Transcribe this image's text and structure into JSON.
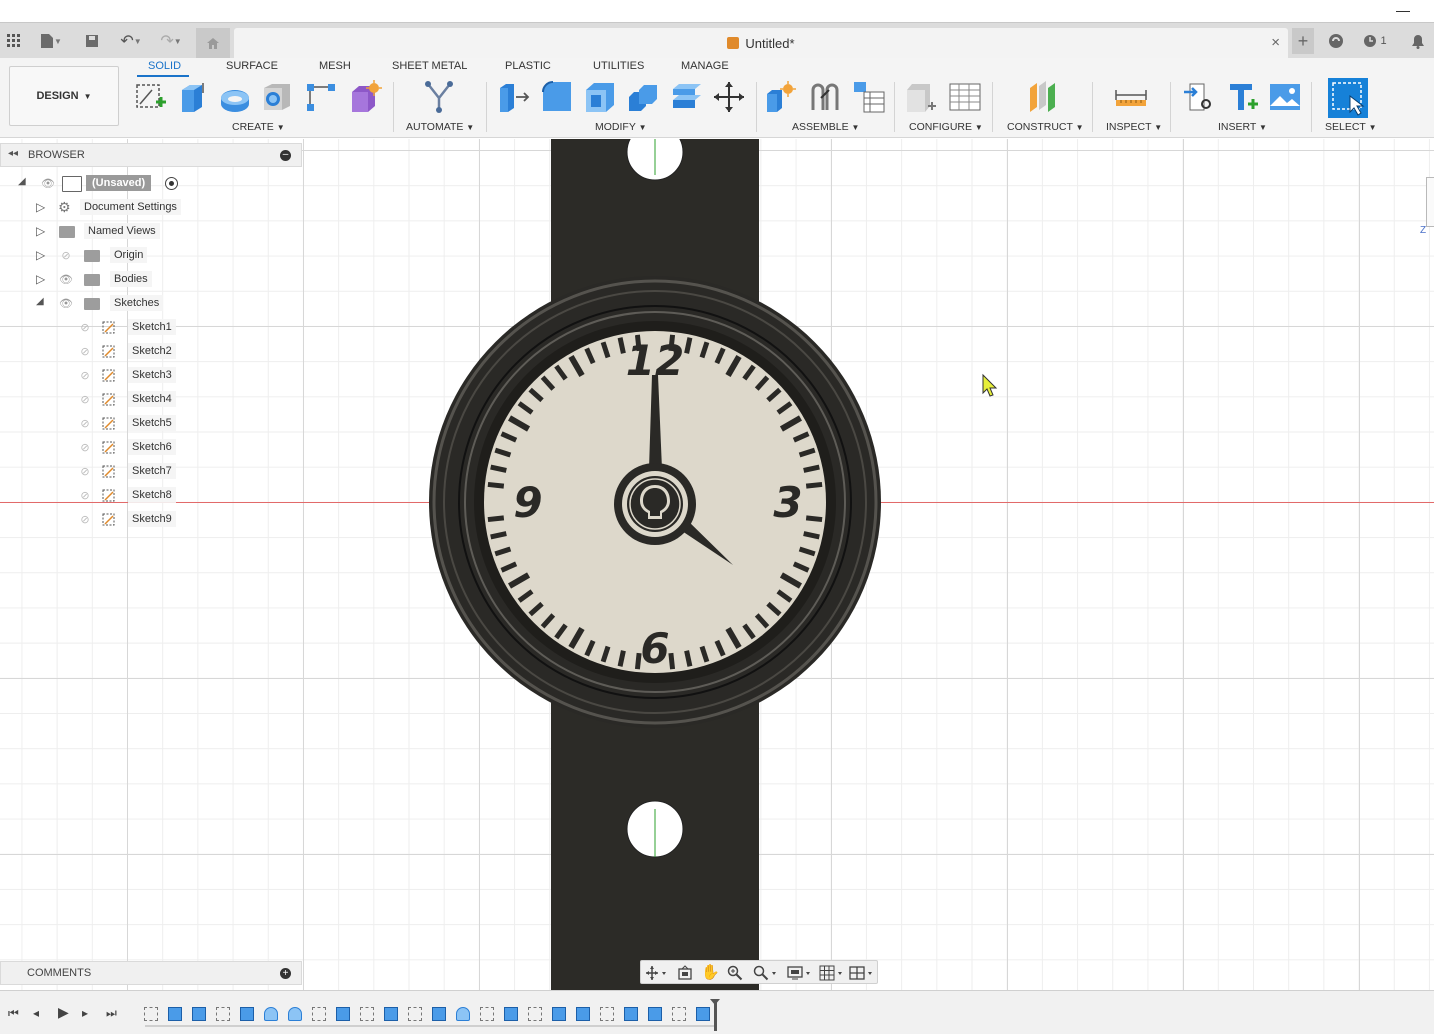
{
  "window": {
    "minimize_glyph": "—"
  },
  "appbar": {
    "icons": [
      "grid-icon",
      "file-icon",
      "save-icon",
      "undo-icon",
      "redo-icon",
      "home-icon"
    ],
    "doc_title": "Untitled*",
    "close_glyph": "×",
    "right": {
      "add_glyph": "+",
      "jobs_count": "1"
    }
  },
  "ribbon": {
    "workspace": "DESIGN",
    "tabs": [
      "SOLID",
      "SURFACE",
      "MESH",
      "SHEET METAL",
      "PLASTIC",
      "UTILITIES",
      "MANAGE"
    ],
    "active_tab": "SOLID",
    "groups": [
      "CREATE",
      "AUTOMATE",
      "MODIFY",
      "ASSEMBLE",
      "CONFIGURE",
      "CONSTRUCT",
      "INSPECT",
      "INSERT",
      "SELECT"
    ],
    "colors": {
      "accent": "#1a73c9",
      "select_bg": "#1681d8"
    }
  },
  "browser": {
    "title": "BROWSER",
    "root": "(Unsaved)",
    "items": [
      "Document Settings",
      "Named Views",
      "Origin",
      "Bodies",
      "Sketches"
    ],
    "sketches": [
      "Sketch1",
      "Sketch2",
      "Sketch3",
      "Sketch4",
      "Sketch5",
      "Sketch6",
      "Sketch7",
      "Sketch8",
      "Sketch9"
    ]
  },
  "comments": {
    "title": "COMMENTS"
  },
  "viewport": {
    "dial_numbers": [
      "12",
      "3",
      "6",
      "9"
    ],
    "strap_color": "#2c2b27",
    "face_color": "#ddd8cb",
    "viewcube": "Z"
  }
}
